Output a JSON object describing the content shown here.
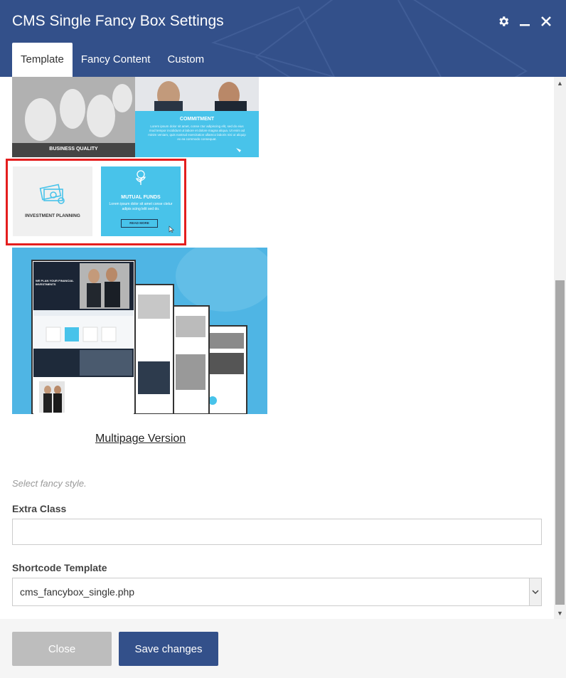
{
  "window": {
    "title": "CMS Single Fancy Box Settings"
  },
  "header_icons": [
    "gear-icon",
    "minimize-icon",
    "close-icon"
  ],
  "tabs": [
    {
      "label": "Template",
      "active": true
    },
    {
      "label": "Fancy Content",
      "active": false
    },
    {
      "label": "Custom",
      "active": false
    }
  ],
  "templates": {
    "item1": {
      "left_caption": "BUSINESS QUALITY",
      "right_title": "COMMITMENT",
      "right_text": "Lorem ipsum dolor sit amet, conse ctur adipiscing elit, sed do eius mod tempor incididunt ut labore et dolore magna aliqua. Ut enim ad minim veniam, quis nostrud exercitation ullamco laboris nisi ut aliquip ex ea commodo consequat."
    },
    "item2": {
      "left_caption": "INVESTMENT PLANNING",
      "right_title": "MUTUAL FUNDS",
      "right_text": "Lorem ipsum dolor sit amet conse ctetur adipis scing lelit sed do.",
      "button": "READ MORE",
      "selected": true
    },
    "item3": {
      "hero_text": "WE PLAN YOUR FINANCIAL INVESTMENTS"
    }
  },
  "multipage_link": "Multipage Version",
  "hint": "Select fancy style.",
  "extra_class": {
    "label": "Extra Class",
    "value": ""
  },
  "shortcode_template": {
    "label": "Shortcode Template",
    "value": "cms_fancybox_single.php"
  },
  "footer": {
    "close_label": "Close",
    "save_label": "Save changes"
  },
  "colors": {
    "header": "#33508a",
    "accent_cyan": "#48c3ea",
    "selection": "#e41e1e"
  }
}
